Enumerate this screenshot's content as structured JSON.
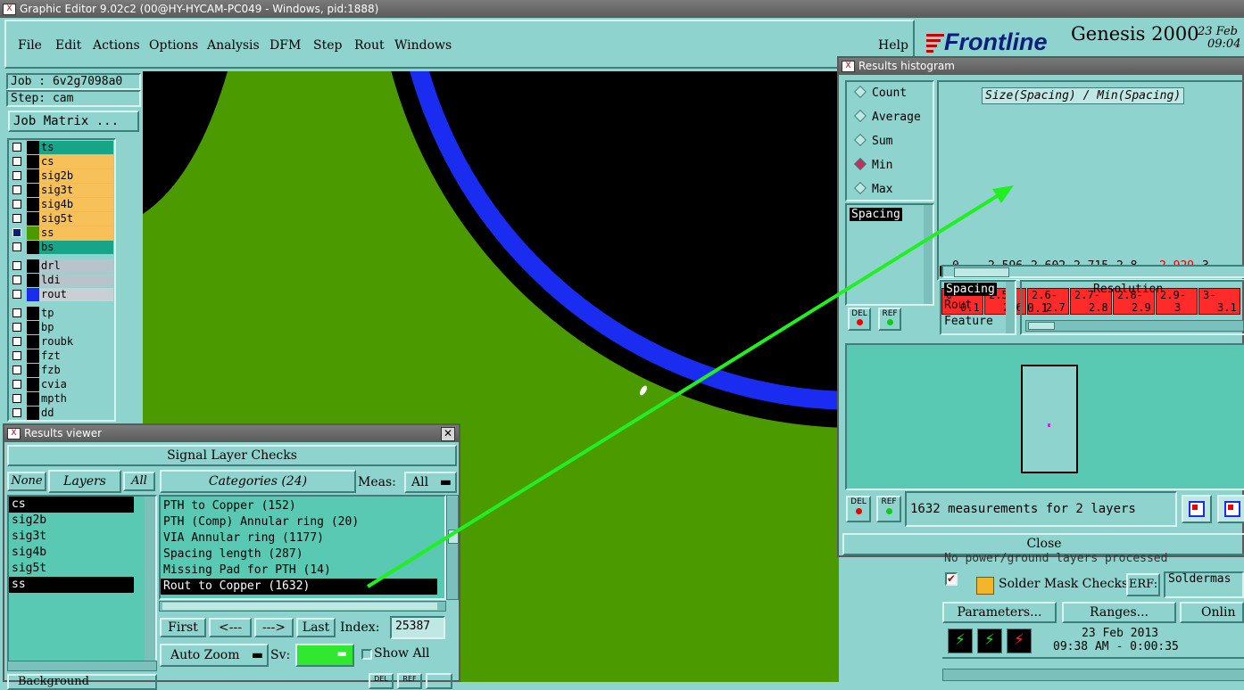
{
  "app_title": "Graphic Editor 9.02c2 (00@HY-HYCAM-PC049 - Windows, pid:1888)",
  "menu": {
    "file": "File",
    "edit": "Edit",
    "actions": "Actions",
    "options": "Options",
    "analysis": "Analysis",
    "dfm": "DFM",
    "step": "Step",
    "rout": "Rout",
    "windows": "Windows",
    "help": "Help"
  },
  "brand": {
    "logo": "Frontline",
    "product": "Genesis 2000",
    "date_partial": "23 Feb",
    "time_partial": "09:04"
  },
  "job": {
    "job": "Job : 6v2g7098a0",
    "step": "Step: cam",
    "matrix": "Job Matrix ..."
  },
  "layers": [
    {
      "name": "ts",
      "color": "#17a589"
    },
    {
      "name": "cs",
      "color": "#f8c058"
    },
    {
      "name": "sig2b",
      "color": "#f8c058"
    },
    {
      "name": "sig3t",
      "color": "#f8c058"
    },
    {
      "name": "sig4b",
      "color": "#f8c058"
    },
    {
      "name": "sig5t",
      "color": "#f8c058"
    },
    {
      "name": "ss",
      "color": "#f8c058"
    },
    {
      "name": "bs",
      "color": "#17a589"
    },
    {
      "name": "drl",
      "color": "#b8c4cc"
    },
    {
      "name": "ldi",
      "color": "#b8c4cc"
    },
    {
      "name": "rout",
      "color": "#c8d0d6"
    },
    {
      "name": "tp",
      "color": "#8fd3cf"
    },
    {
      "name": "bp",
      "color": "#8fd3cf"
    },
    {
      "name": "roubk",
      "color": "#8fd3cf"
    },
    {
      "name": "fzt",
      "color": "#8fd3cf"
    },
    {
      "name": "fzb",
      "color": "#8fd3cf"
    },
    {
      "name": "cvia",
      "color": "#8fd3cf"
    },
    {
      "name": "mpth",
      "color": "#8fd3cf"
    },
    {
      "name": "dd",
      "color": "#8fd3cf"
    }
  ],
  "results_viewer": {
    "title": "Results viewer",
    "header": "Signal Layer Checks",
    "none": "None",
    "layers_label": "Layers",
    "all": "All",
    "layer_list": [
      "cs",
      "sig2b",
      "sig3t",
      "sig4b",
      "sig5t",
      "ss"
    ],
    "categories_label": "Categories (24)",
    "meas_label": "Meas:",
    "meas_value": "All",
    "categories": [
      "PTH to Copper (152)",
      "PTH (Comp) Annular ring (20)",
      "VIA Annular ring (1177)",
      "Spacing length (287)",
      "Missing Pad for PTH (14)",
      "Rout to Copper (1632)"
    ],
    "first": "First",
    "prev": "<---",
    "next": "--->",
    "last": "Last",
    "index_label": "Index:",
    "index_value": "25387",
    "auto_zoom": "Auto Zoom",
    "sv_label": "Sv:",
    "show_all": "Show All",
    "bottom_label": "Background"
  },
  "histogram": {
    "title": "Results histogram",
    "modes": [
      "Count",
      "Average",
      "Sum",
      "Min",
      "Max"
    ],
    "selected_mode": "Min",
    "chart_title": "Size(Spacing) / Min(Spacing)",
    "field": "Spacing",
    "values": [
      "0",
      "2.596",
      "2.602",
      "2.715",
      "2.8",
      "2.929",
      "3"
    ],
    "bins": [
      [
        "0-",
        "0.1"
      ],
      [
        "2.5-",
        "2.6"
      ],
      [
        "2.6-",
        "2.7"
      ],
      [
        "2.7-",
        "2.8"
      ],
      [
        "2.8-",
        "2.9"
      ],
      [
        "2.9-",
        "3"
      ],
      [
        "3-",
        "3.1"
      ]
    ],
    "highlight_color": "#ff2a2a",
    "options": [
      "Spacing",
      "Rout",
      "Feature"
    ],
    "resolution_label": "Resolution",
    "resolution_value": "0.1",
    "del": "DEL",
    "ref": "REF",
    "summary": "1632 measurements for 2 layers",
    "close": "Close"
  },
  "checklist": {
    "status_line": "No power/ground layers processed",
    "solder_mask": "Solder Mask Checks",
    "erf": "ERF:",
    "erf_value": "Soldermas",
    "parameters": "Parameters...",
    "ranges": "Ranges...",
    "online": "Onlin",
    "date": "23 Feb 2013",
    "time": "09:38 AM - 0:00:35"
  }
}
